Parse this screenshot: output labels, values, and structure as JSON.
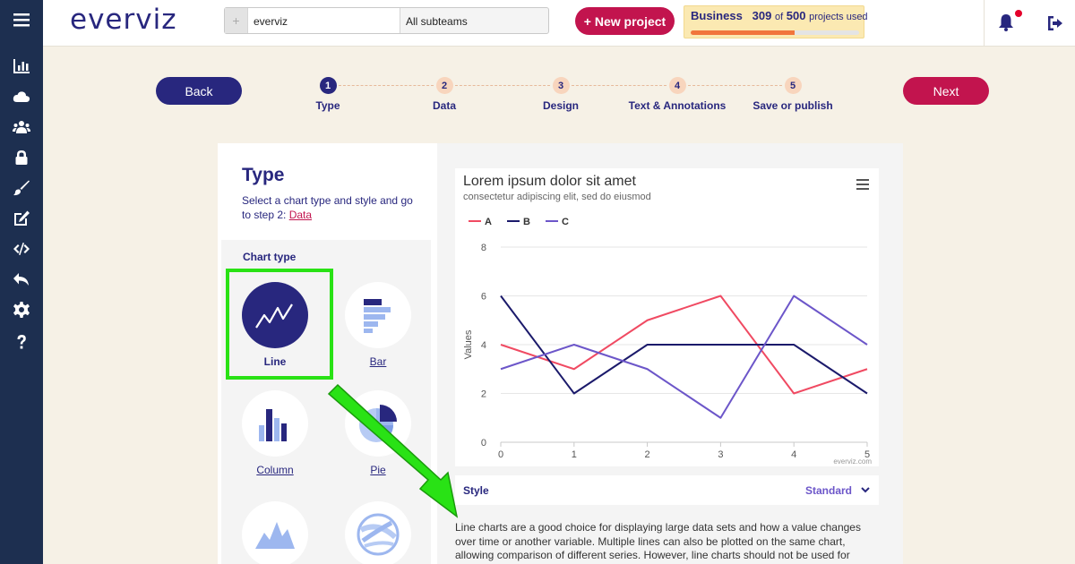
{
  "app": {
    "logo": "everviz"
  },
  "sidebar": {
    "icons": [
      "menu-icon",
      "chart-icon",
      "cloud-icon",
      "users-icon",
      "lock-icon",
      "brush-icon",
      "edit-icon",
      "code-icon",
      "undo-icon",
      "gear-icon",
      "help-icon"
    ]
  },
  "header": {
    "search": {
      "plus": "+",
      "team": "everviz",
      "subteam": "All subteams"
    },
    "new_project_label": "+ New project",
    "plan": {
      "name": "Business",
      "used": "309",
      "of": "of",
      "total": "500",
      "suffix": "projects used",
      "fraction": 0.618
    }
  },
  "wizard": {
    "back_label": "Back",
    "next_label": "Next",
    "steps": [
      {
        "num": "1",
        "label": "Type"
      },
      {
        "num": "2",
        "label": "Data"
      },
      {
        "num": "3",
        "label": "Design"
      },
      {
        "num": "4",
        "label": "Text & Annotations"
      },
      {
        "num": "5",
        "label": "Save or publish"
      }
    ],
    "active_step": 0
  },
  "type_panel": {
    "title": "Type",
    "desc": "Select a chart type and style and go to step 2: ",
    "desc_link": "Data",
    "chart_type_title": "Chart type",
    "chart_types": [
      {
        "label": "Line"
      },
      {
        "label": "Bar"
      },
      {
        "label": "Column"
      },
      {
        "label": "Pie"
      },
      {
        "label": ""
      },
      {
        "label": ""
      }
    ]
  },
  "preview": {
    "style_label": "Style",
    "style_value": "Standard",
    "description": "Line charts are a good choice for displaying large data sets and how a value changes over time or another variable. Multiple lines can also be plotted on the same chart, allowing comparison of different series. However, line charts should not be used for"
  },
  "chart_data": {
    "type": "line",
    "title": "Lorem ipsum dolor sit amet",
    "subtitle": "consectetur adipiscing elit, sed do eiusmod",
    "ylabel": "Values",
    "xlabel": "",
    "credit": "everviz.com",
    "x": [
      0,
      1,
      2,
      3,
      4,
      5
    ],
    "ylim": [
      0,
      8
    ],
    "yticks": [
      0,
      2,
      4,
      6,
      8
    ],
    "legend_position": "top-left",
    "grid": true,
    "series": [
      {
        "name": "A",
        "color": "#f04a62",
        "values": [
          4,
          3,
          5,
          6,
          2,
          3
        ]
      },
      {
        "name": "B",
        "color": "#1b1a6b",
        "values": [
          6,
          2,
          4,
          4,
          4,
          2
        ]
      },
      {
        "name": "C",
        "color": "#6c56c9",
        "values": [
          3,
          4,
          3,
          1,
          6,
          4
        ]
      }
    ]
  },
  "colors": {
    "navy": "#28277e",
    "crimson": "#c2144e",
    "sidebar": "#1d2f50",
    "highlight": "#29e215"
  }
}
